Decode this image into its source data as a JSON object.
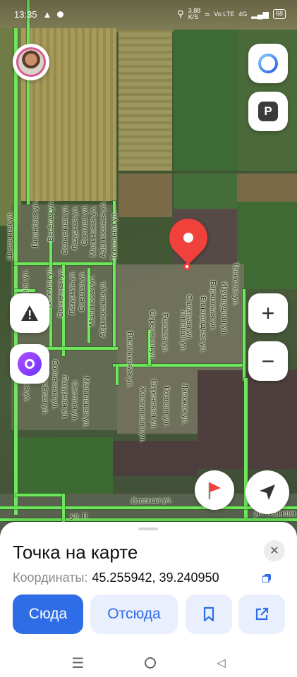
{
  "status_bar": {
    "time": "13:35",
    "network_speed": "3,88\nK/S",
    "network_type": "Vo LTE",
    "network_gen": "4G",
    "battery": "68"
  },
  "map": {
    "streets": {
      "tsvetochnaya": "Цветочная ул.",
      "vishnevaya_1": "Вишнёвая ул.",
      "vishnevaya_2": "Вишнёвая ул.",
      "veselaya_1": "Весёлая ул.",
      "veselaya_2": "Весёлая ул.",
      "veselaya_3": "Весёлая ул.",
      "solnechnaya_1": "Солнечная ул.",
      "solnechnaya_2": "Солнечная ул.",
      "solnechnaya_3": "Солнечная ул.",
      "lazurnaya_1": "Лазурная ул.",
      "lazurnaya_2": "Лазурная ул.",
      "lazurnaya_3": "Лазурная ул.",
      "svetlaya_1": "Светлая ул.",
      "svetlaya_2": "Светлая ул.",
      "svetlaya_3": "Светлая ул.",
      "malinovaya_1": "Малиновая ул.",
      "malinovaya_2": "Малиновая ул.",
      "abrikosovaya_1": "Абрикосовая ул.",
      "abrikosovaya_2": "Абрикосовая ул.",
      "topolinaya": "Тополиная ул.",
      "zelenaya": "Зелёная ул.",
      "vasilkovaya": "Васильковая ул.",
      "sirenevaya_1": "Сиреневая ул.",
      "sirenevaya_2": "Сиреневая ул.",
      "rozovaya_1": "Розовая ул.",
      "rozovaya_2": "Розовая ул.",
      "lipovaya_1": "Липовая ул.",
      "lipovaya_2": "Липовая ул.",
      "zhasminovaya": "Жасминовая ул.",
      "salatnaya": "Салатная ул.",
      "vinogradnaya": "Виноградная ул.",
      "biryuzovaya": "Бирюзовая ул.",
      "izumrudnaya": "Изумрудная ул.",
      "tenistaya": "Тенистая ул.",
      "stepnaya": "Степная ул.",
      "ul_v": "ул. В",
      "ivanova": "ул. Иванова"
    }
  },
  "place_card": {
    "title": "Точка на карте",
    "coords_label": "Координаты:",
    "coords_value": "45.255942, 39.240950",
    "btn_here": "Сюда",
    "btn_from": "Отсюда"
  },
  "colors": {
    "accent": "#2f6de6",
    "accent_light": "#e9effc",
    "pin": "#f0413a",
    "road": "#6ee85a"
  }
}
